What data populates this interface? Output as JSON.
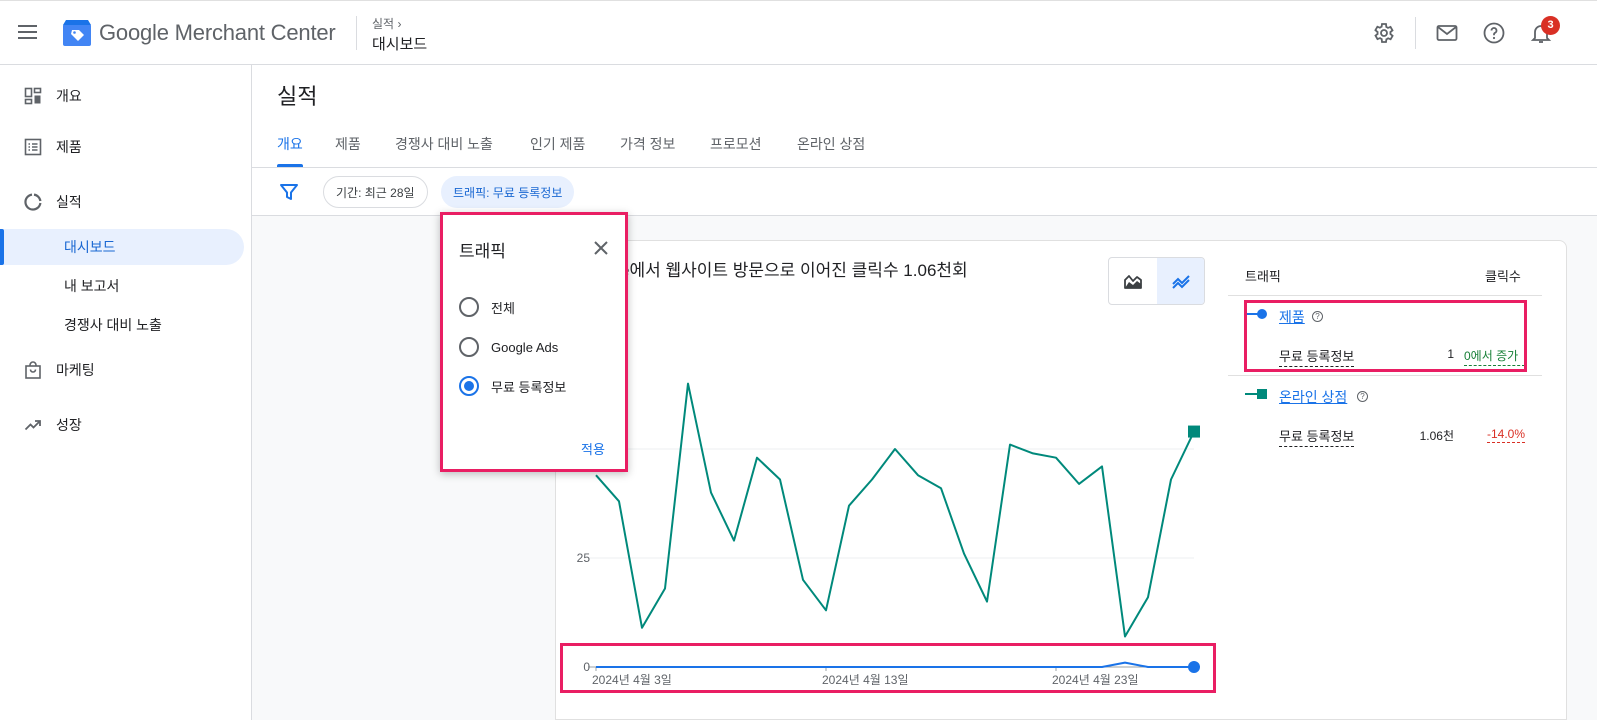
{
  "header": {
    "app_title_google": "Google",
    "app_title_rest": " Merchant Center",
    "breadcrumb_parent": "실적",
    "breadcrumb_current": "대시보드",
    "notification_count": "3"
  },
  "sidebar": {
    "items": [
      {
        "label": "개요",
        "icon": "dashboard-icon"
      },
      {
        "label": "제품",
        "icon": "list-icon"
      },
      {
        "label": "실적",
        "icon": "donut-icon"
      },
      {
        "label": "대시보드",
        "sub": true,
        "active": true
      },
      {
        "label": "내 보고서",
        "sub": true
      },
      {
        "label": "경쟁사 대비 노출",
        "sub": true
      },
      {
        "label": "마케팅",
        "icon": "shopping-bag-icon"
      },
      {
        "label": "성장",
        "icon": "trending-up-icon"
      }
    ]
  },
  "main": {
    "page_title": "실적",
    "tabs": [
      "개요",
      "제품",
      "경쟁사 대비 노출",
      "인기 제품",
      "가격 정보",
      "프로모션",
      "온라인 상점"
    ],
    "active_tab": 0,
    "filters": {
      "period_chip": "기간: 최근 28일",
      "traffic_chip": "트래픽: 무료 등록정보"
    }
  },
  "popup": {
    "title": "트래픽",
    "options": [
      "전체",
      "Google Ads",
      "무료 등록정보"
    ],
    "selected": 2,
    "apply_label": "적용"
  },
  "chart": {
    "title_visible": "e에서 웹사이트 방문으로 이어진 클릭수 1.06천회"
  },
  "chart_data": {
    "type": "line",
    "x_tick_labels": [
      "2024년 4월 3일",
      "2024년 4월 13일",
      "2024년 4월 23일"
    ],
    "y_tick_labels": [
      "0",
      "25"
    ],
    "series": [
      {
        "name": "온라인 상점",
        "color": "#00897b",
        "values": [
          44,
          38,
          9,
          18,
          65,
          40,
          29,
          48,
          43,
          20,
          13,
          37,
          43,
          50,
          44,
          41,
          26,
          15,
          51,
          49,
          48,
          42,
          46,
          7,
          16,
          43,
          54
        ]
      },
      {
        "name": "제품",
        "color": "#1a73e8",
        "values": [
          0,
          0,
          0,
          0,
          0,
          0,
          0,
          0,
          0,
          0,
          0,
          0,
          0,
          0,
          0,
          0,
          0,
          0,
          0,
          0,
          0,
          0,
          0,
          1,
          0,
          0,
          0
        ]
      }
    ],
    "grid": true
  },
  "right_panel": {
    "col_traffic": "트래픽",
    "col_clicks": "클릭수",
    "rows": [
      {
        "name": "제품",
        "sub": "무료 등록정보",
        "value": "1",
        "change": "0에서 증가",
        "direction": "up",
        "color": "#1a73e8"
      },
      {
        "name": "온라인 상점",
        "sub": "무료 등록정보",
        "value": "1.06천",
        "change": "-14.0%",
        "direction": "down",
        "color": "#00897b"
      }
    ]
  },
  "colors": {
    "accent": "#1a73e8",
    "highlight": "#e91e63"
  }
}
